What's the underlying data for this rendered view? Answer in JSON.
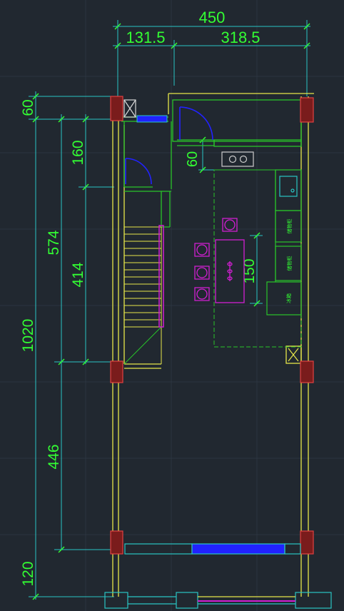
{
  "dimensions": {
    "top_total": "450",
    "top_left": "131.5",
    "top_right": "318.5",
    "left_60": "60",
    "left_574": "574",
    "left_1020": "1020",
    "left_446": "446",
    "left_120": "120",
    "inner_160": "160",
    "inner_414": "414",
    "door_60": "60",
    "table_150": "150"
  },
  "fixtures": {
    "cabinet_1": "储物柜",
    "cabinet_2": "储物柜",
    "cabinet_3": "冰箱"
  },
  "colors": {
    "background": "#212830",
    "wall": "#e6e64a",
    "dimension": "#33ff33",
    "extension": "#29c4c4",
    "column": "#c0392b",
    "door": "#2222ff",
    "furniture": "#d21ed2",
    "kitchen": "#29c429"
  }
}
